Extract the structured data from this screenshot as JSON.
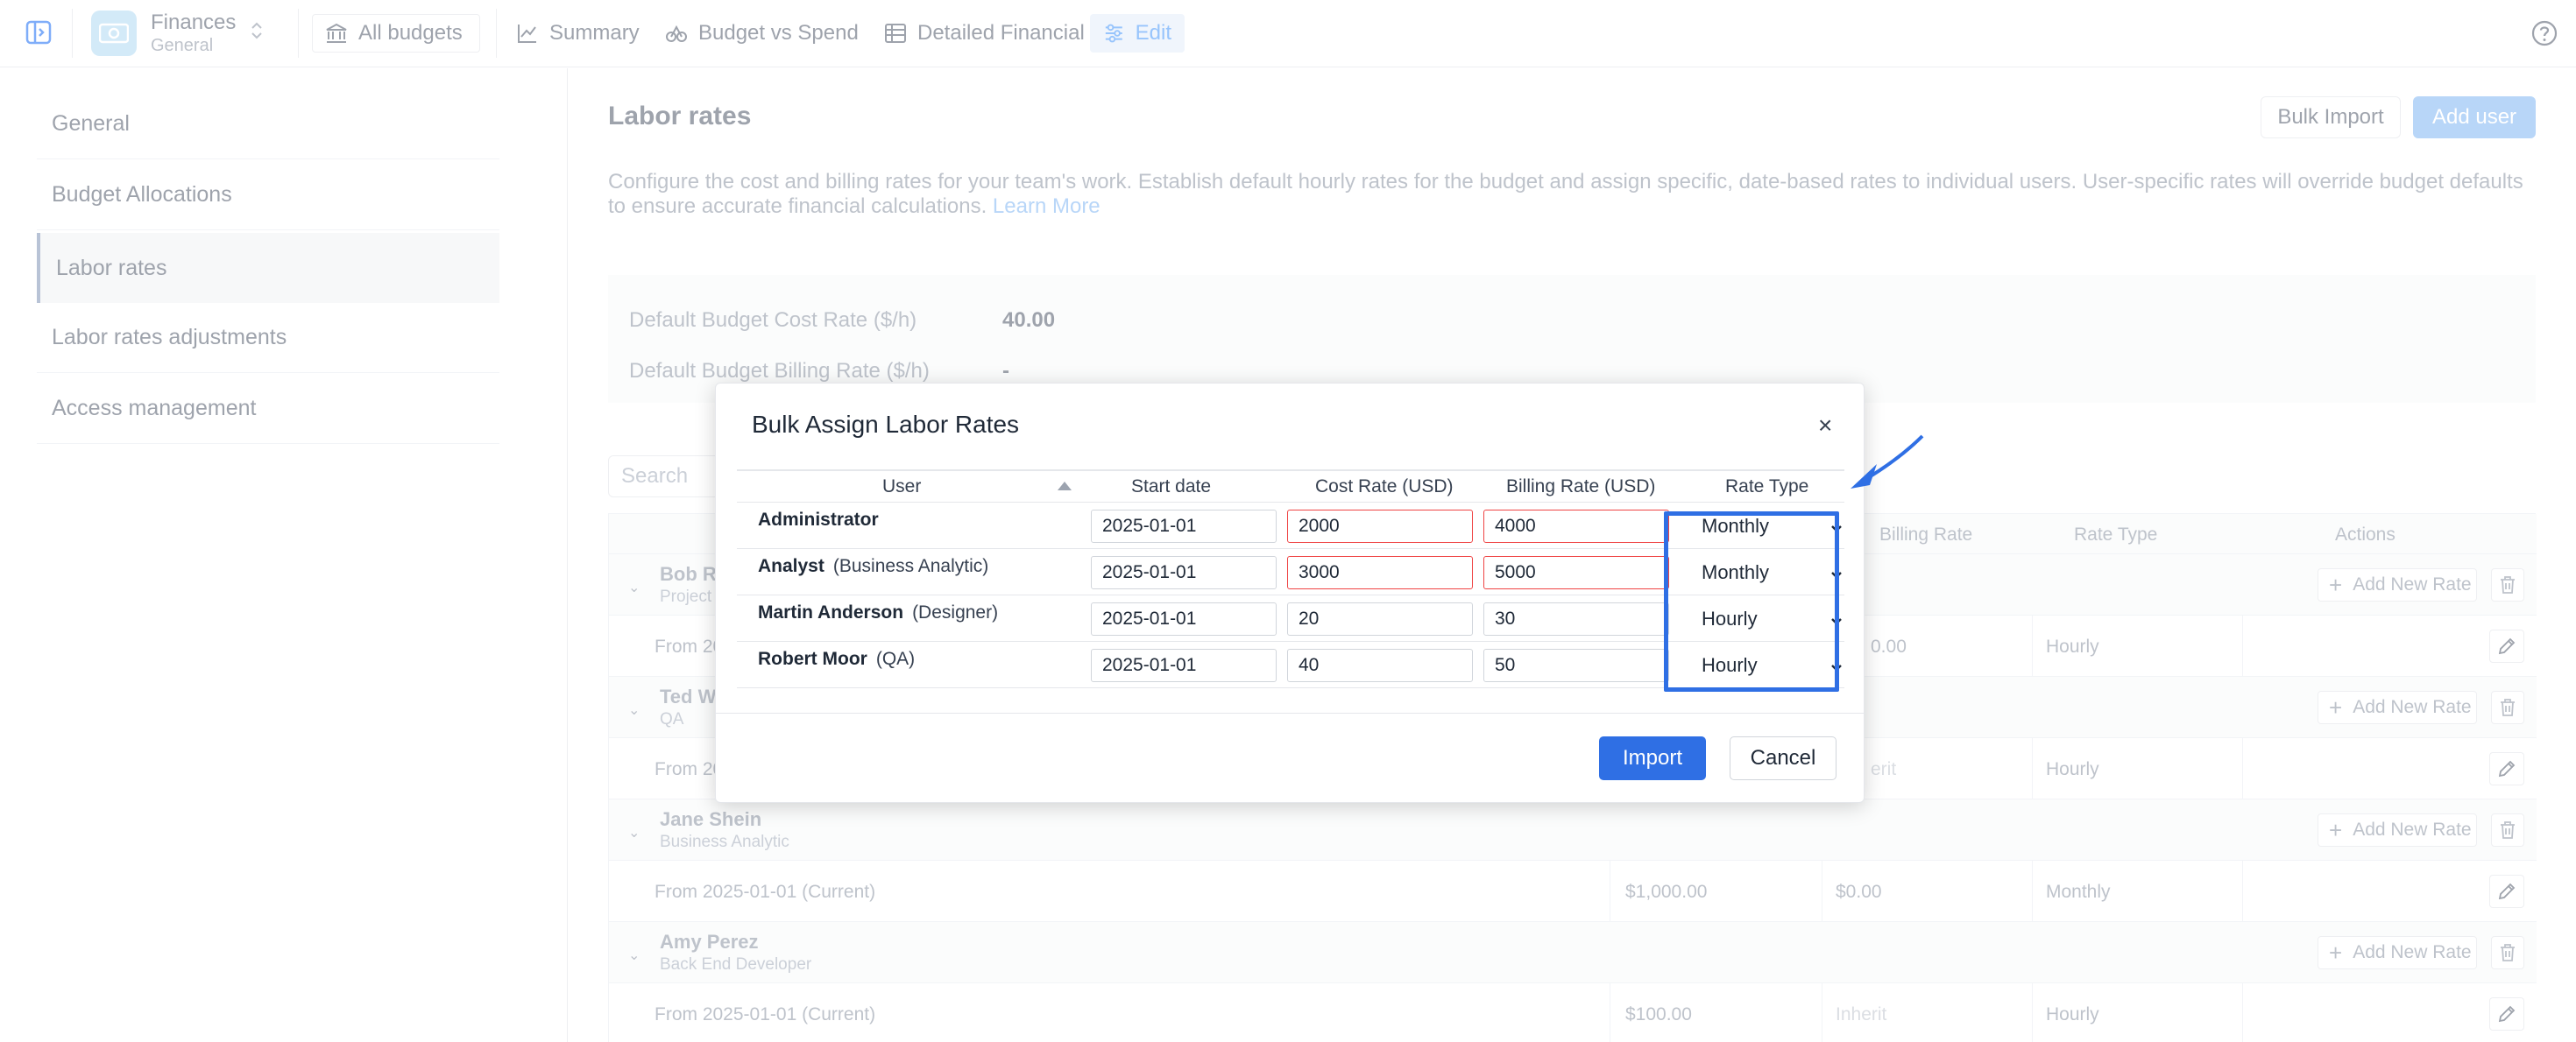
{
  "topbar": {
    "app_title": "Finances",
    "app_subtitle": "General",
    "nav": [
      {
        "label": "All budgets",
        "icon": "bank-icon"
      },
      {
        "label": "Summary",
        "icon": "chart-line-icon"
      },
      {
        "label": "Budget vs Spend",
        "icon": "scale-icon"
      },
      {
        "label": "Detailed Financial",
        "icon": "table-icon"
      },
      {
        "label": "Edit",
        "icon": "sliders-icon",
        "active": true
      }
    ]
  },
  "sidebar": {
    "items": [
      {
        "label": "General"
      },
      {
        "label": "Budget Allocations"
      },
      {
        "label": "Labor rates",
        "active": true
      },
      {
        "label": "Labor rates adjustments"
      },
      {
        "label": "Access management"
      }
    ]
  },
  "main": {
    "title": "Labor rates",
    "bulk_import_label": "Bulk Import",
    "add_user_label": "Add user",
    "description": "Configure the cost and billing rates for your team's work. Establish default hourly rates for the budget and assign specific, date-based rates to individual users. User-specific rates will override budget defaults to ensure accurate financial calculations.",
    "learn_more": "Learn More",
    "default_cost_label": "Default Budget Cost Rate ($/h)",
    "default_cost_value": "40.00",
    "default_billing_label": "Default Budget Billing Rate ($/h)",
    "default_billing_value": "-",
    "search_placeholder": "Search",
    "table_headers": {
      "billing_rate": "Billing Rate",
      "rate_type": "Rate Type",
      "actions": "Actions"
    },
    "add_new_rate_label": "Add New Rate",
    "users": [
      {
        "name": "Bob Ro",
        "role": "Project",
        "rate_from": "From 20",
        "cost": "",
        "billing": "0.00",
        "type": "Hourly"
      },
      {
        "name": "Ted W",
        "role": "QA",
        "rate_from": "From 20",
        "cost": "",
        "billing": "erit",
        "type": "Hourly"
      },
      {
        "name": "Jane Shein",
        "role": "Business Analytic",
        "rate_from": "From 2025-01-01 (Current)",
        "cost": "$1,000.00",
        "billing": "$0.00",
        "type": "Monthly"
      },
      {
        "name": "Amy Perez",
        "role": "Back End Developer",
        "rate_from": "From 2025-01-01 (Current)",
        "cost": "$100.00",
        "billing": "Inherit",
        "type": "Hourly"
      }
    ]
  },
  "modal": {
    "title": "Bulk Assign Labor Rates",
    "close": "×",
    "headers": {
      "user": "User",
      "start_date": "Start date",
      "cost_rate": "Cost Rate (USD)",
      "billing_rate": "Billing Rate (USD)",
      "rate_type": "Rate Type"
    },
    "rows": [
      {
        "user": "Administrator",
        "role": "",
        "start": "2025-01-01",
        "cost": "2000",
        "billing": "4000",
        "type": "Monthly",
        "cost_error": true,
        "billing_error": true
      },
      {
        "user": "Analyst",
        "role": "(Business Analytic)",
        "start": "2025-01-01",
        "cost": "3000",
        "billing": "5000",
        "type": "Monthly",
        "cost_error": true,
        "billing_error": true
      },
      {
        "user": "Martin Anderson",
        "role": "(Designer)",
        "start": "2025-01-01",
        "cost": "20",
        "billing": "30",
        "type": "Hourly",
        "cost_error": false,
        "billing_error": false
      },
      {
        "user": "Robert Moor",
        "role": "(QA)",
        "start": "2025-01-01",
        "cost": "40",
        "billing": "50",
        "type": "Hourly",
        "cost_error": false,
        "billing_error": false
      }
    ],
    "import_label": "Import",
    "cancel_label": "Cancel"
  },
  "colors": {
    "accent": "#2f6fe4",
    "error": "#ef4444",
    "annotation": "#2f6fe4"
  }
}
